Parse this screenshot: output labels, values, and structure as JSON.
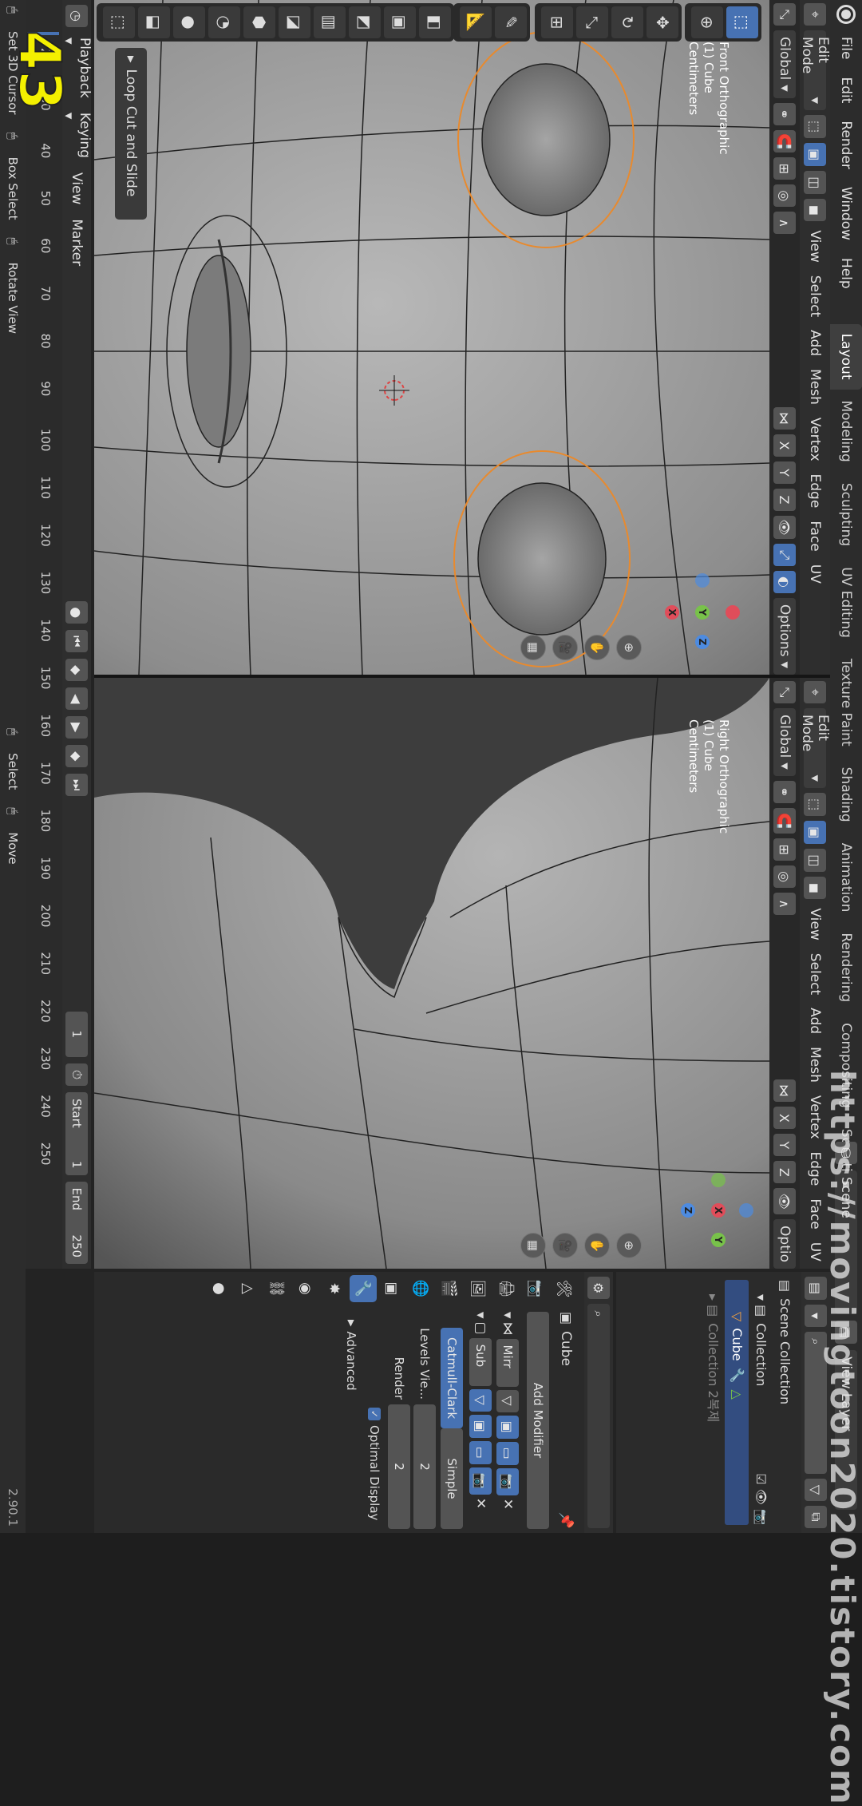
{
  "app": {
    "menu": [
      "File",
      "Edit",
      "Render",
      "Window",
      "Help"
    ],
    "workspace_tabs": [
      "Layout",
      "Modeling",
      "Sculpting",
      "UV Editing",
      "Texture Paint",
      "Shading",
      "Animation",
      "Rendering",
      "Compositing",
      "Scripting"
    ],
    "active_tab": "Layout",
    "scene": "Scene",
    "view_layer": "View Layer",
    "version": "2.90.1"
  },
  "viewport_left": {
    "mode": "Edit Mode",
    "menus": [
      "View",
      "Select",
      "Add",
      "Mesh",
      "Vertex",
      "Edge",
      "Face",
      "UV"
    ],
    "transform": "Global",
    "axes": [
      "X",
      "Y",
      "Z"
    ],
    "options": "Options",
    "info": [
      "Front Orthographic",
      "(1) Cube",
      "Centimeters"
    ],
    "operator_panel": "Loop Cut and Slide"
  },
  "viewport_right": {
    "mode": "Edit Mode",
    "menus": [
      "View",
      "Select",
      "Add",
      "Mesh",
      "Vertex",
      "Edge",
      "Face",
      "UV"
    ],
    "transform": "Global",
    "axes": [
      "X",
      "Y",
      "Z"
    ],
    "options": "Optio",
    "info": [
      "Right Orthographic",
      "(1) Cube",
      "Centimeters"
    ]
  },
  "outliner": {
    "root": "Scene Collection",
    "collection": "Collection",
    "object": "Cube",
    "collection2": "Collection 2복제"
  },
  "properties": {
    "object_name": "Cube",
    "add_modifier": "Add Modifier",
    "mod1_name": "Mirr",
    "mod2_name": "Sub",
    "catmull": "Catmull-Clark",
    "simple": "Simple",
    "levels_label": "Levels Vie...",
    "levels_value": "2",
    "render_label": "Render",
    "render_value": "2",
    "optimal": "Optimal Display",
    "advanced": "Advanced"
  },
  "timeline": {
    "playback": "Playback",
    "keying": "Keying",
    "view": "View",
    "marker": "Marker",
    "current_frame": "1",
    "start_label": "Start",
    "start": "1",
    "end_label": "End",
    "end": "250",
    "ticks": [
      "20",
      "30",
      "40",
      "50",
      "60",
      "70",
      "80",
      "90",
      "100",
      "110",
      "120",
      "130",
      "140",
      "150",
      "160",
      "170",
      "180",
      "190",
      "200",
      "210",
      "220",
      "230",
      "240",
      "250"
    ]
  },
  "status": {
    "set_cursor": "Set 3D Cursor",
    "box_select": "Box Select",
    "rotate": "Rotate View",
    "select": "Select",
    "move": "Move"
  },
  "overlay": {
    "step_number": "43",
    "watermark": "https://movingtoon2020.tistory.com"
  }
}
